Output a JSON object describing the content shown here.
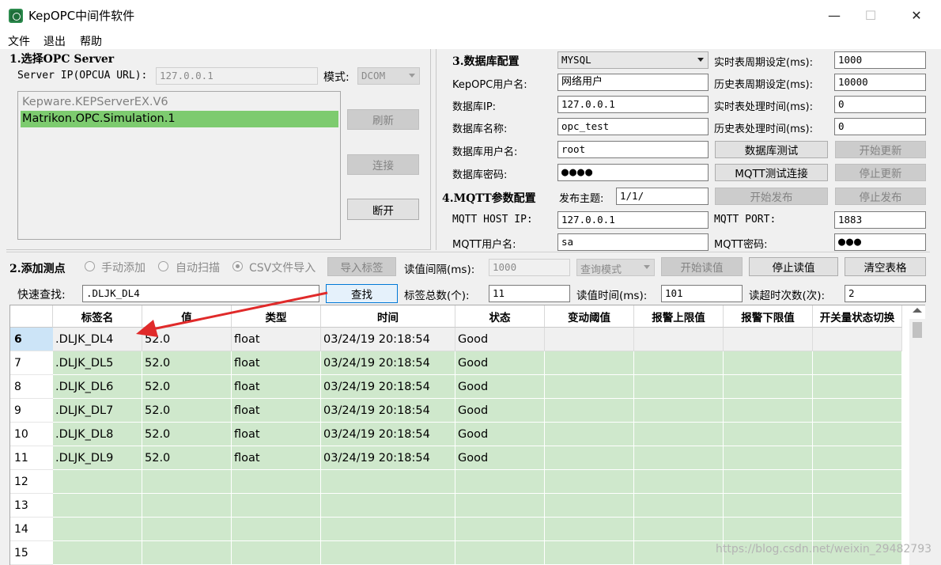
{
  "window": {
    "title": "KepOPC中间件软件",
    "minimize": "—",
    "maximize": "☐",
    "close": "✕"
  },
  "menu": [
    "文件",
    "退出",
    "帮助"
  ],
  "opc": {
    "group_title": "1.选择OPC Server",
    "server_ip_label": "Server IP(OPCUA URL):",
    "server_ip_value": "127.0.0.1",
    "mode_label": "模式:",
    "mode_value": "DCOM",
    "servers": [
      "Kepware.KEPServerEX.V6",
      "Matrikon.OPC.Simulation.1"
    ],
    "refresh": "刷新",
    "connect": "连接",
    "disconnect": "断开"
  },
  "db": {
    "group_title": "3.数据库配置",
    "db_type": "MYSQL",
    "user_label": "KepOPC用户名:",
    "user_value": "网络用户",
    "ip_label": "数据库IP:",
    "ip_value": "127.0.0.1",
    "name_label": "数据库名称:",
    "name_value": "opc_test",
    "dbuser_label": "数据库用户名:",
    "dbuser_value": "root",
    "pwd_label": "数据库密码:",
    "pwd_value": "●●●●",
    "rt_period_label": "实时表周期设定(ms):",
    "rt_period_value": "1000",
    "hist_period_label": "历史表周期设定(ms):",
    "hist_period_value": "10000",
    "rt_proc_label": "实时表处理时间(ms):",
    "rt_proc_value": "0",
    "hist_proc_label": "历史表处理时间(ms):",
    "hist_proc_value": "0",
    "db_test": "数据库测试",
    "start_update": "开始更新",
    "mqtt_test": "MQTT测试连接",
    "stop_update": "停止更新"
  },
  "mqtt": {
    "group_title": "4.MQTT参数配置",
    "topic_label": "发布主题:",
    "topic_value": "1/1/",
    "start_publish": "开始发布",
    "stop_publish": "停止发布",
    "host_label": "MQTT HOST IP:",
    "host_value": "127.0.0.1",
    "port_label": "MQTT PORT:",
    "port_value": "1883",
    "user_label": "MQTT用户名:",
    "user_value": "sa",
    "pwd_label": "MQTT密码:",
    "pwd_value": "●●●"
  },
  "tags": {
    "group_title": "2.添加测点",
    "manual": "手动添加",
    "auto": "自动扫描",
    "csv": "CSV文件导入",
    "import": "导入标签",
    "interval_label": "读值间隔(ms):",
    "interval_value": "1000",
    "query_mode": "查询模式",
    "start_read": "开始读值",
    "stop_read": "停止读值",
    "clear_table": "清空表格",
    "search_label": "快速查找:",
    "search_value": ".DLJK_DL4",
    "search_button": "查找",
    "total_label": "标签总数(个):",
    "total_value": "11",
    "read_time_label": "读值时间(ms):",
    "read_time_value": "101",
    "timeout_label": "读超时次数(次):",
    "timeout_value": "2"
  },
  "table": {
    "columns": [
      "标签名",
      "值",
      "类型",
      "时间",
      "状态",
      "变动阈值",
      "报警上限值",
      "报警下限值",
      "开关量状态切换"
    ],
    "rows": [
      {
        "idx": "6",
        "cells": [
          ".DLJK_DL4",
          "52.0",
          "float",
          "03/24/19 20:18:54",
          "Good",
          "",
          "",
          "",
          ""
        ]
      },
      {
        "idx": "7",
        "cells": [
          ".DLJK_DL5",
          "52.0",
          "float",
          "03/24/19 20:18:54",
          "Good",
          "",
          "",
          "",
          ""
        ]
      },
      {
        "idx": "8",
        "cells": [
          ".DLJK_DL6",
          "52.0",
          "float",
          "03/24/19 20:18:54",
          "Good",
          "",
          "",
          "",
          ""
        ]
      },
      {
        "idx": "9",
        "cells": [
          ".DLJK_DL7",
          "52.0",
          "float",
          "03/24/19 20:18:54",
          "Good",
          "",
          "",
          "",
          ""
        ]
      },
      {
        "idx": "10",
        "cells": [
          ".DLJK_DL8",
          "52.0",
          "float",
          "03/24/19 20:18:54",
          "Good",
          "",
          "",
          "",
          ""
        ]
      },
      {
        "idx": "11",
        "cells": [
          ".DLJK_DL9",
          "52.0",
          "float",
          "03/24/19 20:18:54",
          "Good",
          "",
          "",
          "",
          ""
        ]
      },
      {
        "idx": "12",
        "cells": [
          "",
          "",
          "",
          "",
          "",
          "",
          "",
          "",
          ""
        ]
      },
      {
        "idx": "13",
        "cells": [
          "",
          "",
          "",
          "",
          "",
          "",
          "",
          "",
          ""
        ]
      },
      {
        "idx": "14",
        "cells": [
          "",
          "",
          "",
          "",
          "",
          "",
          "",
          "",
          ""
        ]
      },
      {
        "idx": "15",
        "cells": [
          "",
          "",
          "",
          "",
          "",
          "",
          "",
          "",
          ""
        ]
      }
    ]
  },
  "watermark": "https://blog.csdn.net/weixin_29482793",
  "colors": {
    "row_green": "#cfe8cc",
    "list_selected": "#7dcb6f",
    "arrow_red": "#e02a2a"
  }
}
